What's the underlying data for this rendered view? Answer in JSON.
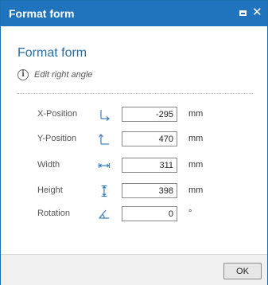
{
  "window": {
    "title": "Format form",
    "controls": {
      "restore_icon": "restore-icon",
      "close_icon": "close-icon",
      "close_glyph": "✕"
    }
  },
  "form": {
    "heading": "Format form",
    "info_glyph": "i",
    "subtitle": "Edit right angle",
    "fields": [
      {
        "label": "X-Position",
        "icon": "x-position-icon",
        "value": "-295",
        "unit": "mm"
      },
      {
        "label": "Y-Position",
        "icon": "y-position-icon",
        "value": "470",
        "unit": "mm"
      },
      {
        "label": "Width",
        "icon": "width-icon",
        "value": "311",
        "unit": "mm"
      },
      {
        "label": "Height",
        "icon": "height-icon",
        "value": "398",
        "unit": "mm"
      },
      {
        "label": "Rotation",
        "icon": "rotation-icon",
        "value": "0",
        "unit": "°"
      }
    ]
  },
  "footer": {
    "ok_label": "OK"
  },
  "colors": {
    "titlebar": "#1f74bd",
    "heading": "#2a6ea8",
    "icon_blue": "#3a7fc1"
  }
}
